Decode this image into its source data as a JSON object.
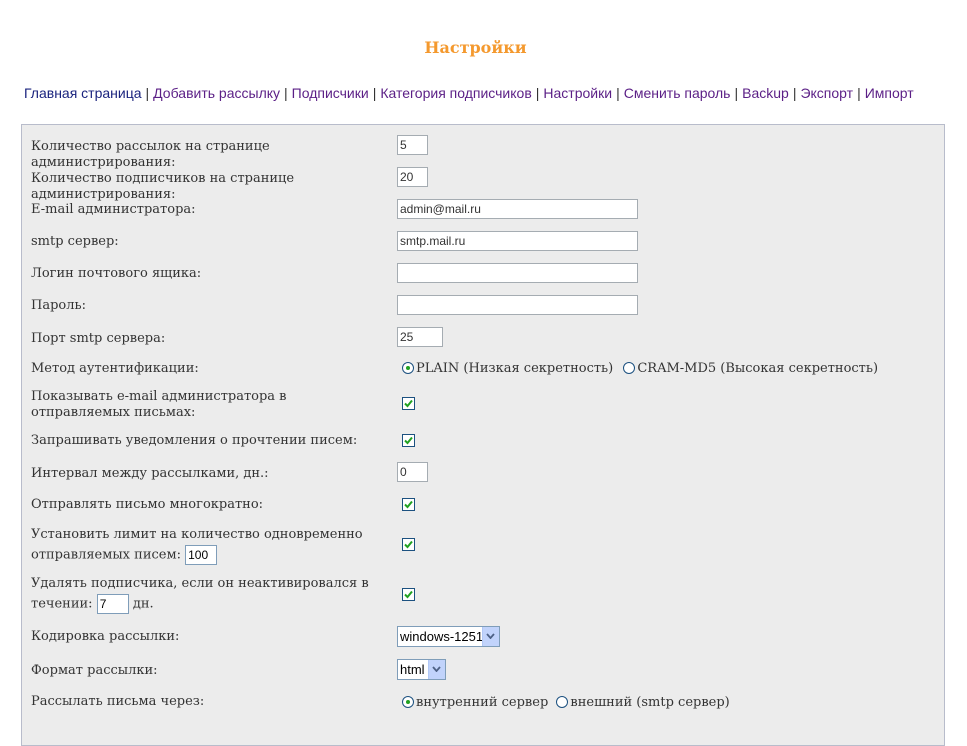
{
  "page": {
    "title": "Настройки"
  },
  "nav": [
    {
      "label": "Главная страница",
      "main": true
    },
    {
      "label": "Добавить рассылку"
    },
    {
      "label": "Подписчики"
    },
    {
      "label": "Категория подписчиков"
    },
    {
      "label": "Настройки"
    },
    {
      "label": "Сменить пароль"
    },
    {
      "label": "Backup"
    },
    {
      "label": "Экспорт"
    },
    {
      "label": "Импорт"
    }
  ],
  "settings": {
    "mailings_per_page_label": "Количество рассылок на странице администрирования:",
    "mailings_per_page": "5",
    "subscribers_per_page_label": "Количество подписчиков на странице администрирования:",
    "subscribers_per_page": "20",
    "admin_email_label": "E-mail администратора:",
    "admin_email": "admin@mail.ru",
    "smtp_server_label": "smtp сервер:",
    "smtp_server": "smtp.mail.ru",
    "login_label": "Логин почтового ящика:",
    "login": "",
    "password_label": "Пароль:",
    "password": "",
    "smtp_port_label": "Порт smtp сервера:",
    "smtp_port": "25",
    "auth_method_label": "Метод аутентификации:",
    "auth_plain": "PLAIN (Низкая секретность)",
    "auth_cram": "CRAM-MD5 (Высокая секретность)",
    "auth_selected": "PLAIN",
    "show_admin_email_label": "Показывать e-mail администратора в отправляемых письмах:",
    "show_admin_email": true,
    "read_receipt_label": "Запрашивать уведомления о прочтении писем:",
    "read_receipt": true,
    "interval_label": "Интервал между рассылками, дн.:",
    "interval": "0",
    "send_multiple_label": "Отправлять письмо многократно:",
    "send_multiple": true,
    "limit_label_1": "Установить лимит на количество одновременно",
    "limit_label_2": "отправляемых писем:",
    "limit_value": "100",
    "limit_enabled": true,
    "delete_inactive_label_1": "Удалять подписчика, если он неактивировался в",
    "delete_inactive_label_2": "течении:",
    "delete_inactive_days": "7",
    "delete_inactive_unit": "дн.",
    "delete_inactive": true,
    "encoding_label": "Кодировка рассылки:",
    "encoding": "windows-1251",
    "format_label": "Формат рассылки:",
    "format": "html",
    "send_via_label": "Рассылать письма через:",
    "send_via_internal": "внутренний сервер",
    "send_via_external": "внешний (smtp сервер)",
    "send_via_selected": "internal"
  },
  "colors": {
    "title": "#f4992e",
    "nav_main": "#1a237e",
    "nav_link": "#5b1f86",
    "panel_bg": "#ececec",
    "check": "#21a121"
  },
  "icons": {
    "checkbox": "checkmark-icon",
    "select": "chevron-down-icon"
  }
}
